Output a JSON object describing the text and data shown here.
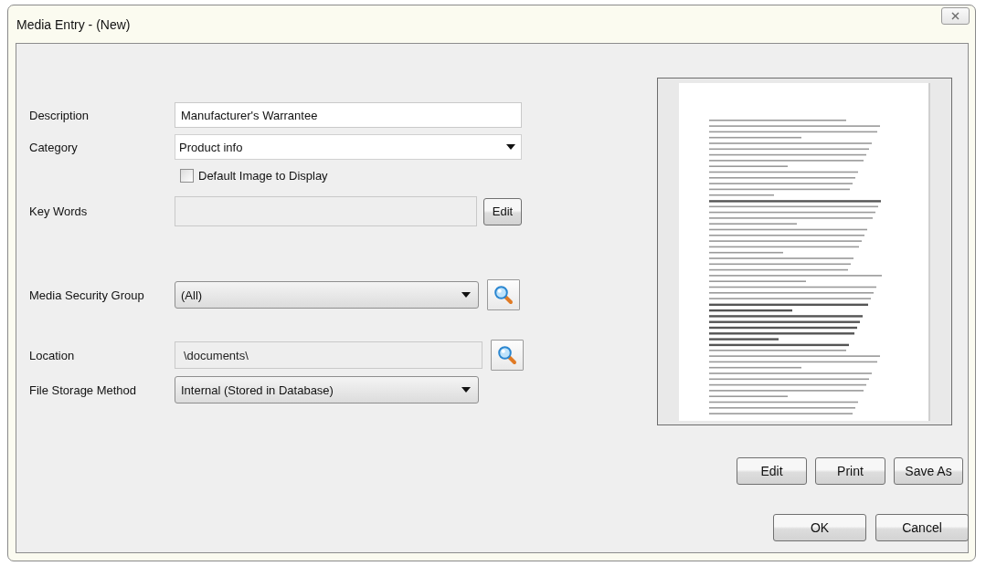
{
  "window": {
    "title": "Media Entry - (New)"
  },
  "fields": [
    {
      "kind": "text",
      "label": "Description",
      "value": "Manufacturer's Warrantee",
      "disabled": false
    },
    {
      "kind": "dropdown",
      "label": "Category",
      "value": "Product info"
    },
    {
      "kind": "checkbox",
      "label": "Default Image to Display",
      "checked": false
    },
    {
      "kind": "text",
      "label": "Key Words",
      "disabled": true,
      "button": "Edit"
    },
    {
      "kind": "combo",
      "label": "Media Security Group",
      "value": "(All)",
      "search": true
    },
    {
      "kind": "text",
      "label": "Location",
      "value": "\\documents\\",
      "disabled": true,
      "search": true
    },
    {
      "kind": "combo",
      "label": "File Storage Method",
      "value": "Internal (Stored in Database)"
    }
  ],
  "preview_buttons": [
    "Edit",
    "Print",
    "Save As"
  ],
  "buttons": [
    "OK",
    "Cancel"
  ]
}
